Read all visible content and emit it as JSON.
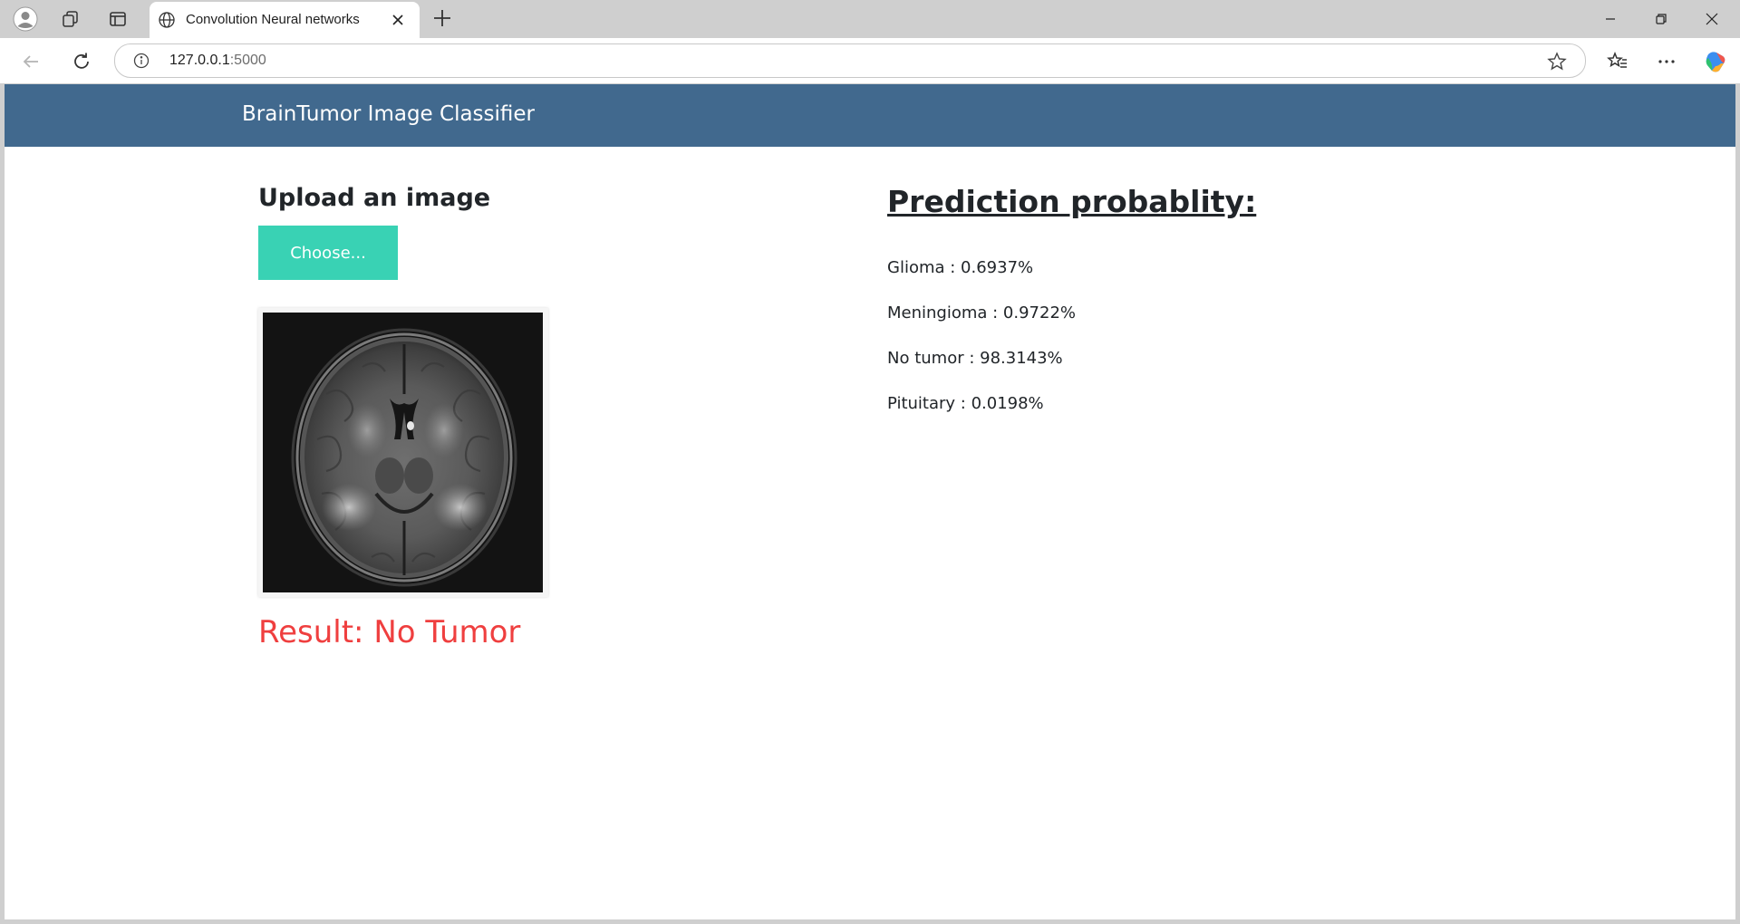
{
  "browser": {
    "tab_title": "Convolution Neural networks",
    "url_host": "127.0.0.1",
    "url_port": ":5000"
  },
  "navbar": {
    "brand": "BrainTumor Image Classifier"
  },
  "upload": {
    "heading": "Upload an image",
    "choose_label": "Choose..."
  },
  "result": {
    "text": "Result: No Tumor",
    "color": "#ef3f3f"
  },
  "prediction": {
    "heading": "Prediction probablity:",
    "items": [
      {
        "label": "Glioma : 0.6937%"
      },
      {
        "label": "Meningioma : 0.9722%"
      },
      {
        "label": "No tumor : 98.3143%"
      },
      {
        "label": "Pituitary : 0.0198%"
      }
    ]
  },
  "colors": {
    "navbar": "#41698e",
    "button": "#39d2b4"
  }
}
